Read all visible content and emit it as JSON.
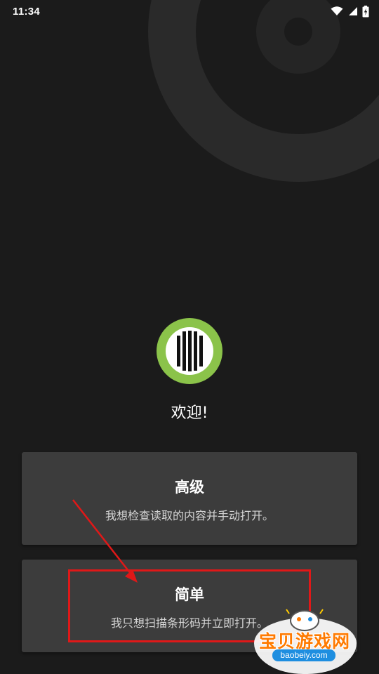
{
  "status_bar": {
    "time": "11:34",
    "icons": [
      "wifi-icon",
      "signal-icon",
      "battery-charging-icon"
    ]
  },
  "colors": {
    "background": "#1b1b1b",
    "card": "#3c3c3c",
    "logo_ring": "#8bc34a",
    "annotation": "#e01818",
    "watermark_orange": "#ff7a00",
    "watermark_blue": "#1e8ee0"
  },
  "logo": {
    "icon": "barcode-logo-icon"
  },
  "welcome": {
    "text": "欢迎!"
  },
  "options": [
    {
      "title": "高级",
      "description": "我想检查读取的内容并手动打开。"
    },
    {
      "title": "简单",
      "description": "我只想扫描条形码并立即打开。"
    }
  ],
  "watermark": {
    "title": "宝贝游戏网",
    "url": "baobeiy.com"
  }
}
